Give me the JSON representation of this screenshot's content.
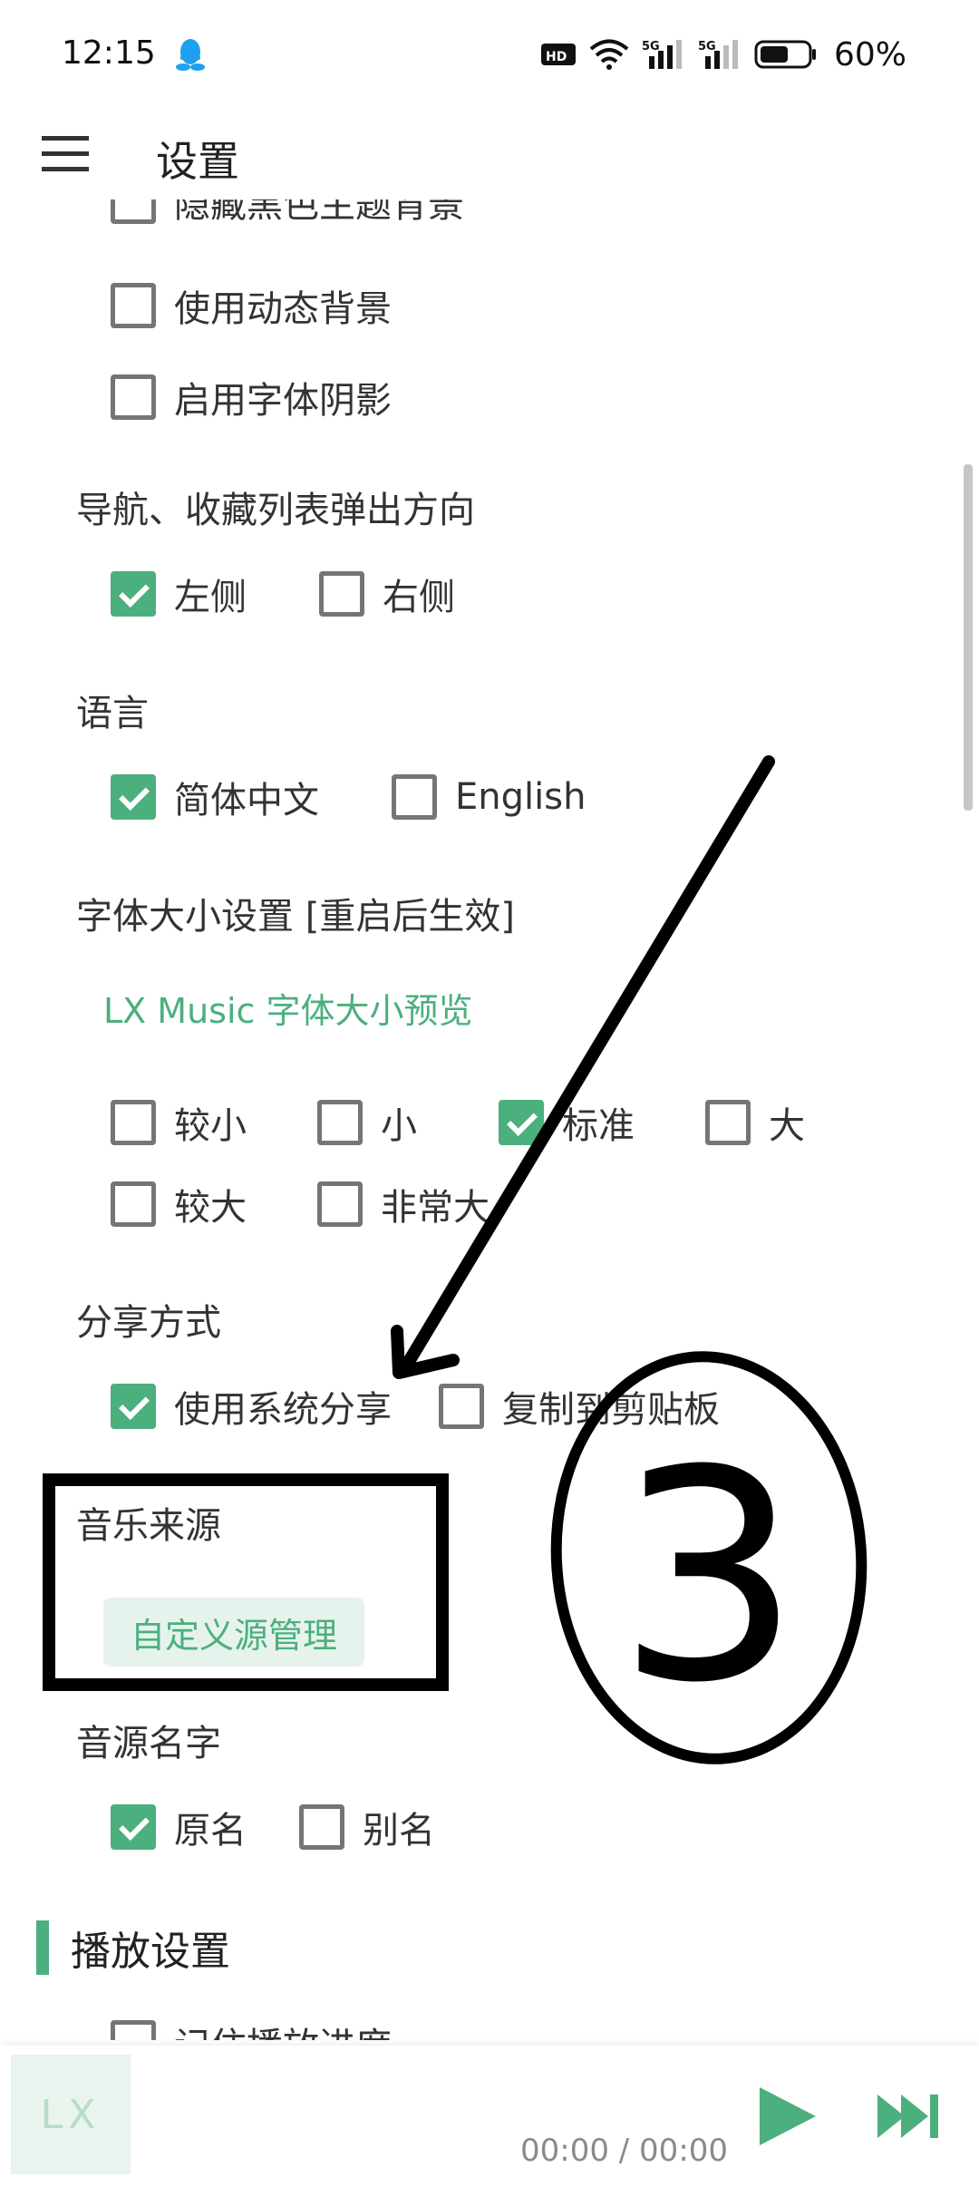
{
  "status_bar": {
    "time": "12:15",
    "battery_percent": "60%",
    "battery_level": 0.6,
    "network_label": "5G",
    "hd_label": "HD"
  },
  "header": {
    "title": "设置"
  },
  "settings": {
    "theme_options": [
      {
        "label": "隐藏黑色主题背景",
        "checked": false
      },
      {
        "label": "使用动态背景",
        "checked": false
      },
      {
        "label": "启用字体阴影",
        "checked": false
      }
    ],
    "nav_direction": {
      "title": "导航、收藏列表弹出方向",
      "options": [
        {
          "label": "左侧",
          "checked": true
        },
        {
          "label": "右侧",
          "checked": false
        }
      ]
    },
    "language": {
      "title": "语言",
      "options": [
        {
          "label": "简体中文",
          "checked": true
        },
        {
          "label": "English",
          "checked": false
        }
      ]
    },
    "font_size": {
      "title": "字体大小设置 [重启后生效]",
      "preview": "LX Music 字体大小预览",
      "options_row1": [
        {
          "label": "较小",
          "checked": false
        },
        {
          "label": "小",
          "checked": false
        },
        {
          "label": "标准",
          "checked": true
        },
        {
          "label": "大",
          "checked": false
        }
      ],
      "options_row2": [
        {
          "label": "较大",
          "checked": false
        },
        {
          "label": "非常大",
          "checked": false
        }
      ]
    },
    "share": {
      "title": "分享方式",
      "options": [
        {
          "label": "使用系统分享",
          "checked": true
        },
        {
          "label": "复制到剪贴板",
          "checked": false
        }
      ]
    },
    "music_source": {
      "title": "音乐来源",
      "button": "自定义源管理"
    },
    "source_name": {
      "title": "音源名字",
      "options": [
        {
          "label": "原名",
          "checked": true
        },
        {
          "label": "别名",
          "checked": false
        }
      ]
    },
    "playback_group": {
      "title": "播放设置",
      "first_option": "记住播放进度"
    }
  },
  "player": {
    "cover_text": "LX",
    "time": "00:00 / 00:00"
  },
  "annotation": {
    "number": "3"
  },
  "colors": {
    "accent": "#4caf7e",
    "accent_light": "#e6f3ec",
    "text": "#333333",
    "checkbox_border": "#757575",
    "annotation_ink": "#000000"
  },
  "icons": {
    "status": [
      "qq-icon",
      "hd-icon",
      "wifi-icon",
      "signal-icon",
      "battery-icon"
    ],
    "header": "menu-icon",
    "player": [
      "play-icon",
      "next-icon"
    ]
  }
}
